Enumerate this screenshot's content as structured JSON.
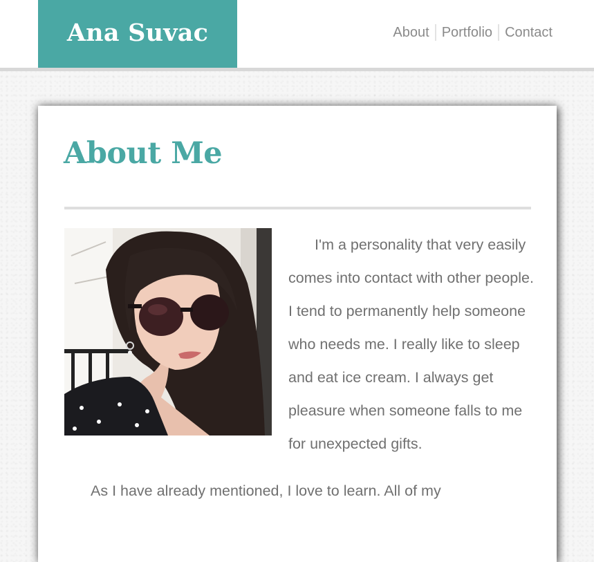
{
  "site": {
    "title": "Ana Suvac"
  },
  "nav": {
    "items": [
      {
        "label": "About"
      },
      {
        "label": "Portfolio"
      },
      {
        "label": "Contact"
      }
    ]
  },
  "page": {
    "title": "About Me",
    "paragraphs": [
      "I'm a personality that very easily comes into contact with other people. I tend to permanently help someone who needs me. I really like to sleep and eat ice cream. I always get pleasure when someone falls to me for unexpected gifts.",
      "As I have already mentioned, I love to learn. All of my"
    ]
  },
  "colors": {
    "accent": "#4aa8a4",
    "text": "#707070",
    "nav_text": "#8a8a8a",
    "divider": "#dedede"
  }
}
